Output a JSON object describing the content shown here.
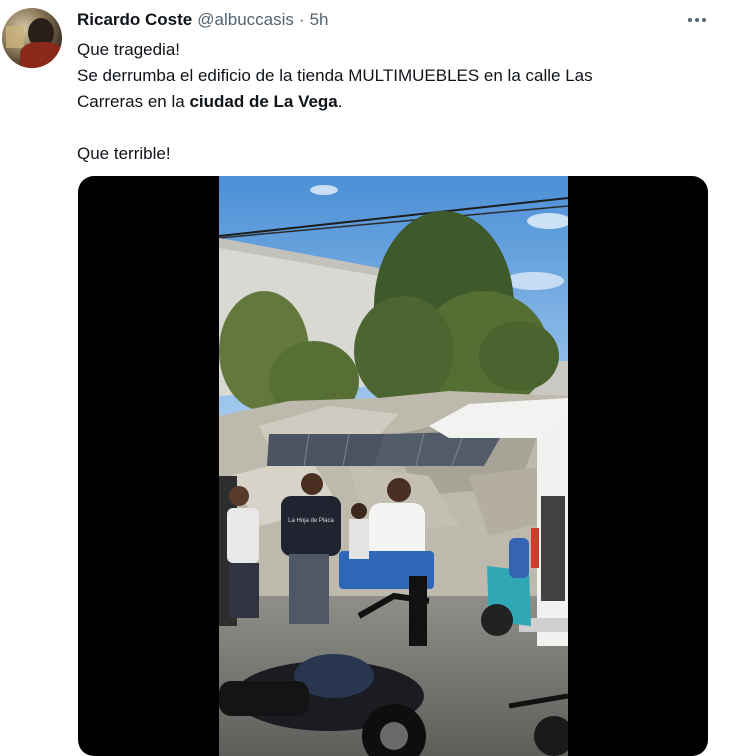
{
  "tweet": {
    "author_name": "Ricardo Coste",
    "author_handle": "@albuccasis",
    "separator": "·",
    "time": "5h",
    "lines": {
      "l1": "Que tragedia!",
      "l2a": "Se derrumba el edificio de la tienda MULTIMUEBLES en la calle Las",
      "l3a": "Carreras en la ",
      "l3b": "ciudad de La Vega",
      "l3c": ".",
      "l4": "Que terrible!"
    }
  },
  "media": {
    "type": "video",
    "shirt_text": "La Hoja de Placa"
  },
  "colors": {
    "text_primary": "#0f1419",
    "text_secondary": "#536471",
    "media_background": "#000000"
  },
  "icons": {
    "more": "more-horizontal-icon"
  }
}
